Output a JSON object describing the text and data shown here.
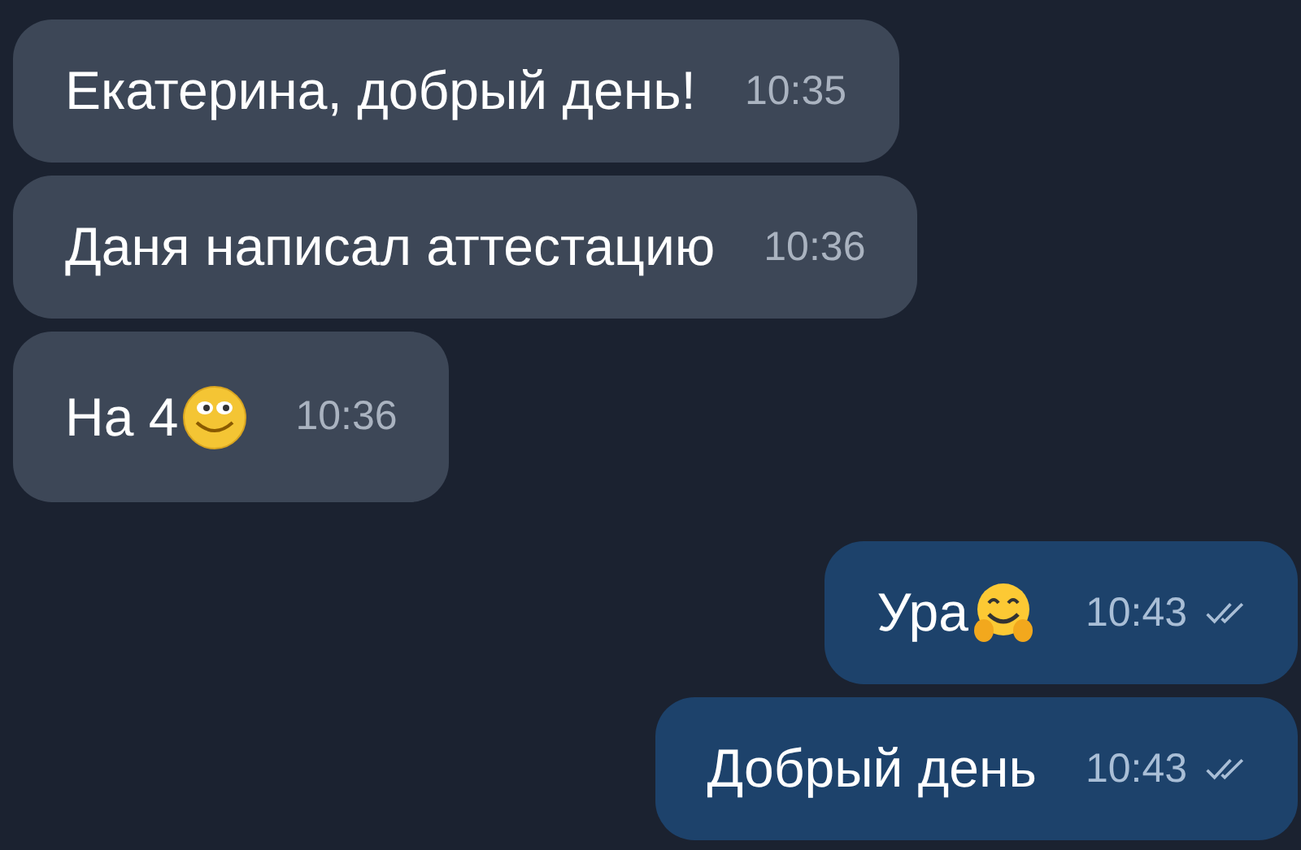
{
  "messages": [
    {
      "kind": "text",
      "outgoing": false,
      "text": "Екатерина, добрый день!",
      "time": "10:35"
    },
    {
      "kind": "text",
      "outgoing": false,
      "text": "Даня написал аттестацию",
      "time": "10:36"
    },
    {
      "kind": "with_smiley",
      "outgoing": false,
      "text": "На 4",
      "time": "10:36"
    },
    {
      "kind": "with_hug",
      "outgoing": true,
      "read": true,
      "text": "Ура",
      "time": "10:43"
    },
    {
      "kind": "text",
      "outgoing": true,
      "read": true,
      "text": "Добрый день",
      "time": "10:43"
    }
  ]
}
